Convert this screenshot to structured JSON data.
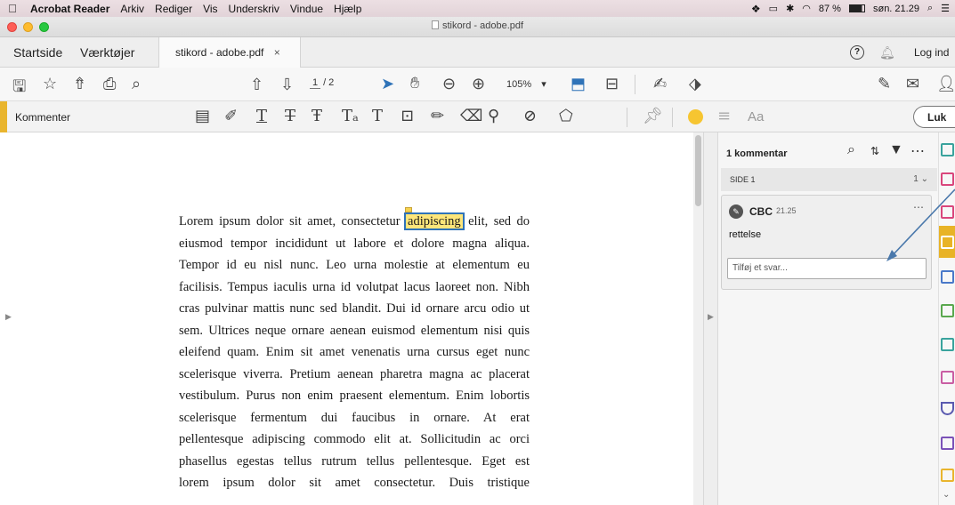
{
  "menubar": {
    "apple": "",
    "app_name": "Acrobat Reader",
    "items": [
      "Arkiv",
      "Rediger",
      "Vis",
      "Underskriv",
      "Vindue",
      "Hjælp"
    ],
    "battery": "87 %",
    "clock": "søn. 21.29"
  },
  "window": {
    "title": "stikord - adobe.pdf"
  },
  "tabs": {
    "home": "Startside",
    "tools": "Værktøjer",
    "document": "stikord - adobe.pdf",
    "close_symbol": "×",
    "help_symbol": "?",
    "login": "Log ind"
  },
  "toolbar": {
    "page_current": "1",
    "page_total": "/ 2",
    "zoom": "105%"
  },
  "comment_toolbar": {
    "label": "Kommenter",
    "text_style_label": "Aa",
    "close_label": "Luk",
    "highlight_color": "#f6c531"
  },
  "document": {
    "lines": [
      [
        "Lorem ipsum dolor sit amet, consectetur ",
        "adipiscing",
        " elit, sed do"
      ],
      "eiusmod tempor incididunt ut labore et dolore magna aliqua.",
      "Tempor id eu nisl nunc. Leo urna molestie at elementum eu",
      "facilisis. Tempus iaculis urna id volutpat lacus laoreet non. Nibh",
      "cras pulvinar mattis nunc sed blandit. Dui id ornare arcu odio ut",
      "sem. Ultrices neque ornare aenean euismod elementum nisi quis",
      "eleifend quam. Enim sit amet venenatis urna cursus eget nunc",
      "scelerisque viverra. Pretium aenean pharetra magna ac placerat",
      "vestibulum. Purus non enim praesent elementum. Enim lobortis",
      "scelerisque fermentum dui faucibus in ornare. At erat",
      "pellentesque adipiscing commodo elit at. Sollicitudin ac orci",
      "phasellus egestas tellus rutrum tellus pellentesque. Eget est",
      "lorem ipsum dolor sit amet consectetur. Duis tristique"
    ]
  },
  "comments_panel": {
    "count_label": "1 kommentar",
    "section_label": "SIDE 1",
    "section_count": "1",
    "comment": {
      "author": "CBC",
      "time": "21.25",
      "text": "rettelse",
      "reply_placeholder": "Tilføj et svar..."
    }
  },
  "colors": {
    "accent_yellow": "#e9b52e",
    "selection_blue": "#2f73b8",
    "highlight_yellow": "#fde67a"
  }
}
